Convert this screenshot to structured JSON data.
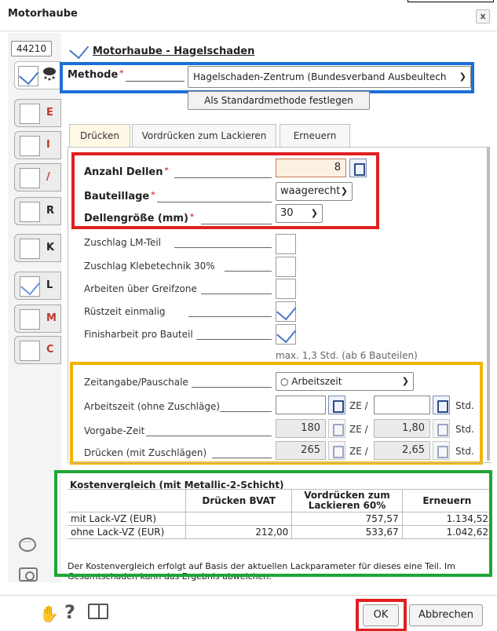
{
  "window": {
    "title": "Motorhaube",
    "close_label": "x"
  },
  "sidebar": {
    "id_value": "44210",
    "tabs": [
      {
        "letter": "",
        "checked": true
      },
      {
        "letter": "E",
        "checked": false,
        "color": "#c0392b"
      },
      {
        "letter": "I",
        "checked": false,
        "color": "#c0392b"
      },
      {
        "letter": "/",
        "checked": false,
        "color": "#c0392b"
      },
      {
        "letter": "R",
        "checked": false,
        "color": "#222222"
      },
      {
        "letter": "K",
        "checked": false,
        "color": "#222222"
      },
      {
        "letter": "L",
        "checked": true,
        "color": "#222222"
      },
      {
        "letter": "M",
        "checked": false,
        "color": "#c0392b"
      },
      {
        "letter": "C",
        "checked": false,
        "color": "#c0392b"
      }
    ]
  },
  "header": {
    "title": "Motorhaube - Hagelschaden"
  },
  "methode": {
    "label": "Methode",
    "required": "*",
    "value": "Hagelschaden-Zentrum (Bundesverband Ausbeultech",
    "standard_button": "Als Standardmethode festlegen"
  },
  "tabs": [
    {
      "label": "Drücken",
      "active": true
    },
    {
      "label": "Vordrücken zum Lackieren",
      "active": false
    },
    {
      "label": "Erneuern",
      "active": false
    }
  ],
  "form": {
    "anzahl_dellen": {
      "label": "Anzahl Dellen",
      "value": "8"
    },
    "bauteillage": {
      "label": "Bauteillage",
      "value": "waagerecht"
    },
    "dellengroesse": {
      "label": "Dellengröße (mm)",
      "value": "30"
    },
    "required_mark": "*",
    "checkbox_rows": [
      {
        "label": "Zuschlag LM-Teil",
        "checked": false
      },
      {
        "label": "Zuschlag Klebetechnik 30%",
        "checked": false
      },
      {
        "label": "Arbeiten über Greifzone",
        "checked": false
      },
      {
        "label": "Rüstzeit einmalig",
        "checked": true
      },
      {
        "label": "Finisharbeit pro Bauteil",
        "checked": true
      }
    ],
    "max_note": "max. 1,3 Std. (ab 6 Bauteilen)"
  },
  "time": {
    "zeitangabe_label": "Zeitangabe/Pauschale",
    "zeitangabe_value": "Arbeitszeit",
    "arbeitszeit_label": "Arbeitszeit (ohne Zuschläge)",
    "vorgabe_label": "Vorgabe-Zeit",
    "druecken_label": "Drücken (mit Zuschlägen)",
    "vorgabe_ze": "180",
    "vorgabe_std": "1,80",
    "druecken_ze": "265",
    "druecken_std": "2,65",
    "ze_unit": "ZE /",
    "std_unit": "Std."
  },
  "kosten": {
    "title": "Kostenvergleich (mit Metallic-2-Schicht)",
    "columns": [
      "",
      "Drücken BVAT",
      "Vordrücken zum Lackieren 60%",
      "Erneuern"
    ],
    "rows": [
      {
        "label": "mit Lack-VZ (EUR)",
        "druecken": "",
        "vordruecken": "757,57",
        "erneuern": "1.134,52"
      },
      {
        "label": "ohne Lack-VZ (EUR)",
        "druecken": "212,00",
        "vordruecken": "533,67",
        "erneuern": "1.042,62"
      }
    ],
    "note": "Der Kostenvergleich erfolgt auf Basis der aktuellen Lackparameter für dieses eine Teil. Im Gesamtschaden kann das Ergebnis abweichen."
  },
  "footer": {
    "ok_label": "OK",
    "cancel_label": "Abbrechen"
  },
  "colors": {
    "highlight_blue": "#1e6fd6",
    "highlight_red": "#e02020",
    "highlight_yellow": "#f0b400",
    "highlight_green": "#1fa637"
  }
}
